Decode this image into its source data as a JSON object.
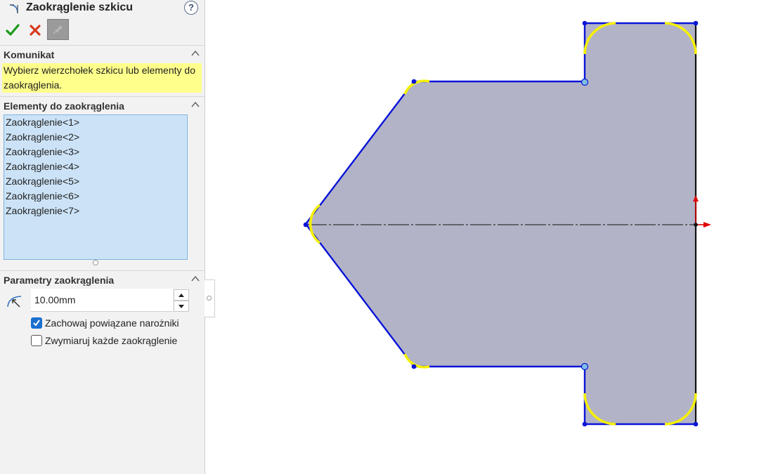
{
  "panel": {
    "title": "Zaokrąglenie szkicu",
    "help_label": "?",
    "message_section": {
      "heading": "Komunikat",
      "text": "Wybierz wierzchołek szkicu lub elementy do zaokrąglenia."
    },
    "entities_section": {
      "heading": "Elementy do zaokrąglenia",
      "items": [
        "Zaokrąglenie<1>",
        "Zaokrąglenie<2>",
        "Zaokrąglenie<3>",
        "Zaokrąglenie<4>",
        "Zaokrąglenie<5>",
        "Zaokrąglenie<6>",
        "Zaokrąglenie<7>"
      ]
    },
    "parameters_section": {
      "heading": "Parametry zaokrąglenia",
      "radius_value": "10.00mm",
      "keep_corners_label": "Zachowaj powiązane narożniki",
      "keep_corners_checked": true,
      "dimension_each_label": "Zwymiaruj każde zaokrąglenie",
      "dimension_each_checked": false
    }
  },
  "colors": {
    "sketch_line": "#0a14d8",
    "fillet_highlight": "#f5f000",
    "region_fill": "#b3b3c8",
    "confirm_green": "#1a9a1a",
    "cancel_red": "#d83a1a",
    "message_bg": "#ffff8c",
    "list_bg": "#cce3f7"
  }
}
